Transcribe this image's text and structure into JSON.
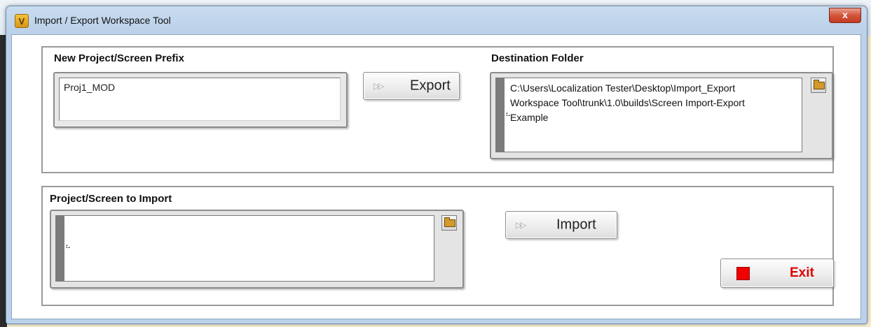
{
  "window": {
    "title": "Import / Export Workspace Tool",
    "app_icon": "V",
    "close_glyph": "x"
  },
  "export_section": {
    "prefix_label": "New Project/Screen Prefix",
    "prefix_value": "Proj1_MOD",
    "export_button": "Export",
    "destination_label": "Destination Folder",
    "destination_lines": [
      "C:\\Users\\Localization Tester\\Desktop\\Import_Export",
      "Workspace Tool\\trunk\\1.0\\builds\\Screen Import-Export",
      "Example"
    ]
  },
  "import_section": {
    "project_label": "Project/Screen to Import",
    "project_value": "",
    "import_button": "Import"
  },
  "exit_button": "Exit",
  "icons": {
    "browse": "folder-icon",
    "button_arrow": "double-arrow-icon",
    "stop": "stop-icon",
    "path": "path-icon"
  },
  "colors": {
    "exit_text": "#e00000",
    "stop_square": "#f00000",
    "title_bar": "#bcd2ea"
  }
}
